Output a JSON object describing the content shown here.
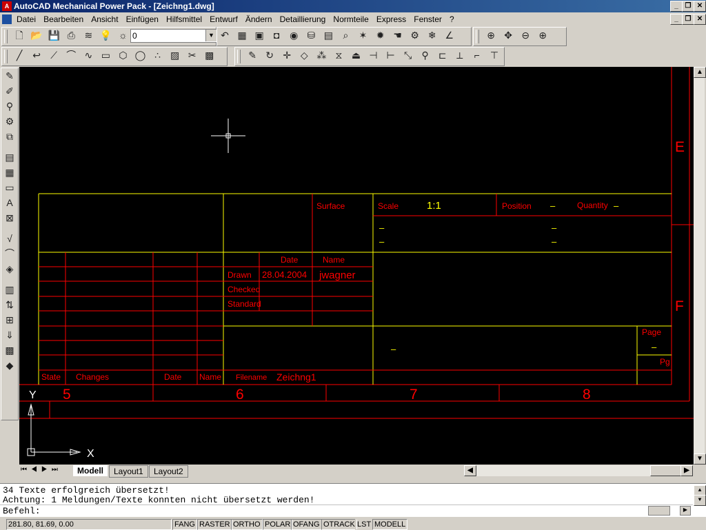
{
  "window": {
    "title": "AutoCAD Mechanical Power Pack - [Zeichng1.dwg]"
  },
  "menu": [
    "Datei",
    "Bearbeiten",
    "Ansicht",
    "Einfügen",
    "Hilfsmittel",
    "Entwurf",
    "Ändern",
    "Detaillierung",
    "Normteile",
    "Express",
    "Fenster",
    "?"
  ],
  "layer": {
    "value": "0"
  },
  "drawing": {
    "title_block": {
      "surface": "Surface",
      "scale_label": "Scale",
      "scale_value": "1:1",
      "position": "Position",
      "quantity": "Quantity",
      "dash": "–",
      "date_header": "Date",
      "name_header": "Name",
      "drawn": "Drawn",
      "drawn_date": "28.04.2004",
      "drawn_name": "jwagner",
      "checked": "Checked",
      "standard": "Standard",
      "page": "Page",
      "pg": "Pg",
      "state": "State",
      "changes": "Changes",
      "date": "Date",
      "name": "Name",
      "filename_label": "Filename",
      "filename_value": "Zeichng1"
    },
    "zones_bottom": [
      "5",
      "6",
      "7",
      "8"
    ],
    "zones_right": [
      "E",
      "F"
    ],
    "ucs": {
      "x": "X",
      "y": "Y"
    }
  },
  "tabs": {
    "model": "Modell",
    "layout1": "Layout1",
    "layout2": "Layout2"
  },
  "command": {
    "line1": "34 Texte erfolgreich übersetzt!",
    "line2": "Achtung: 1 Meldungen/Texte konnten nicht übersetzt werden!",
    "prompt": "Befehl:"
  },
  "status": {
    "coords": "281.80, 81.69, 0.00",
    "buttons": [
      "FANG",
      "RASTER",
      "ORTHO",
      "POLAR",
      "OFANG",
      "OTRACK",
      "LST",
      "MODELL"
    ]
  },
  "colors": {
    "red": "#ff0000",
    "yellow": "#ffff00",
    "canvas": "#000000"
  }
}
